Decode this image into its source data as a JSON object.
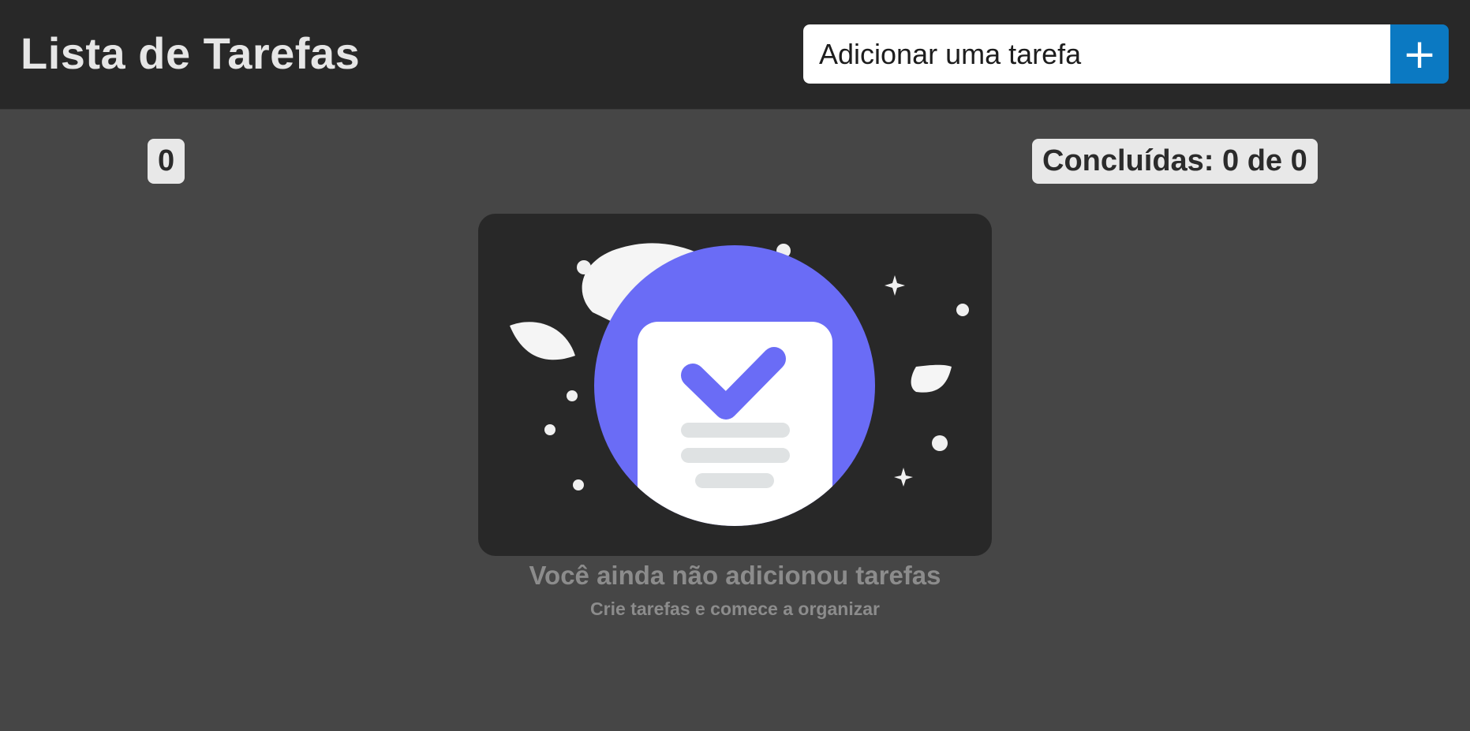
{
  "header": {
    "title": "Lista de Tarefas",
    "input_placeholder": "Adicionar uma tarefa",
    "add_button_label": "+"
  },
  "counters": {
    "created": "0",
    "completed": "Concluídas: 0 de 0"
  },
  "empty_state": {
    "illustration": "task-checklist-illustration",
    "title": "Você ainda não adicionou tarefas",
    "subtitle": "Crie tarefas e comece a organizar"
  },
  "colors": {
    "header_bg": "#282828",
    "page_bg": "#464646",
    "accent": "#0b79c2",
    "illustration_accent": "#6a6cf6"
  }
}
